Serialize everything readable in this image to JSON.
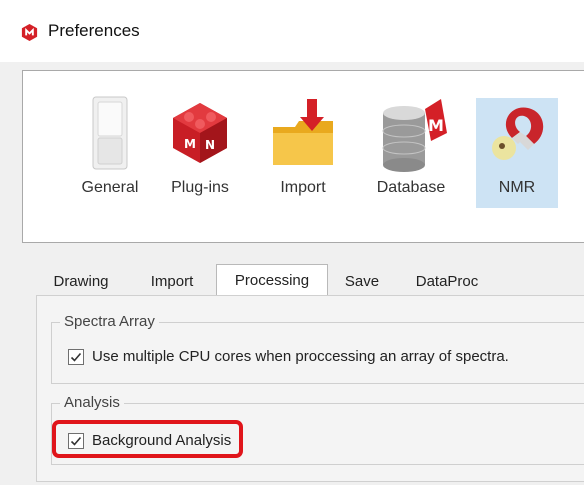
{
  "window": {
    "title": "Preferences"
  },
  "pages": [
    {
      "label": "General",
      "icon": "general-switch-icon"
    },
    {
      "label": "Plug-ins",
      "icon": "plugins-dice-icon"
    },
    {
      "label": "Import",
      "icon": "import-folder-icon"
    },
    {
      "label": "Database",
      "icon": "database-icon"
    },
    {
      "label": "NMR",
      "icon": "nmr-magnet-icon",
      "selected": true
    }
  ],
  "tabs": [
    {
      "label": "Drawing"
    },
    {
      "label": "Import"
    },
    {
      "label": "Processing",
      "active": true
    },
    {
      "label": "Save"
    },
    {
      "label": "DataProc"
    }
  ],
  "processing": {
    "spectra_array": {
      "title": "Spectra Array",
      "use_multiple_cores": {
        "label": "Use multiple CPU cores when proccessing an array of spectra.",
        "checked": true
      }
    },
    "analysis": {
      "title": "Analysis",
      "background_analysis": {
        "label": "Background Analysis",
        "checked": true
      }
    }
  },
  "colors": {
    "accent_highlight": "#e0151b",
    "brand_red": "#d42027",
    "selection": "#cde3f4"
  }
}
